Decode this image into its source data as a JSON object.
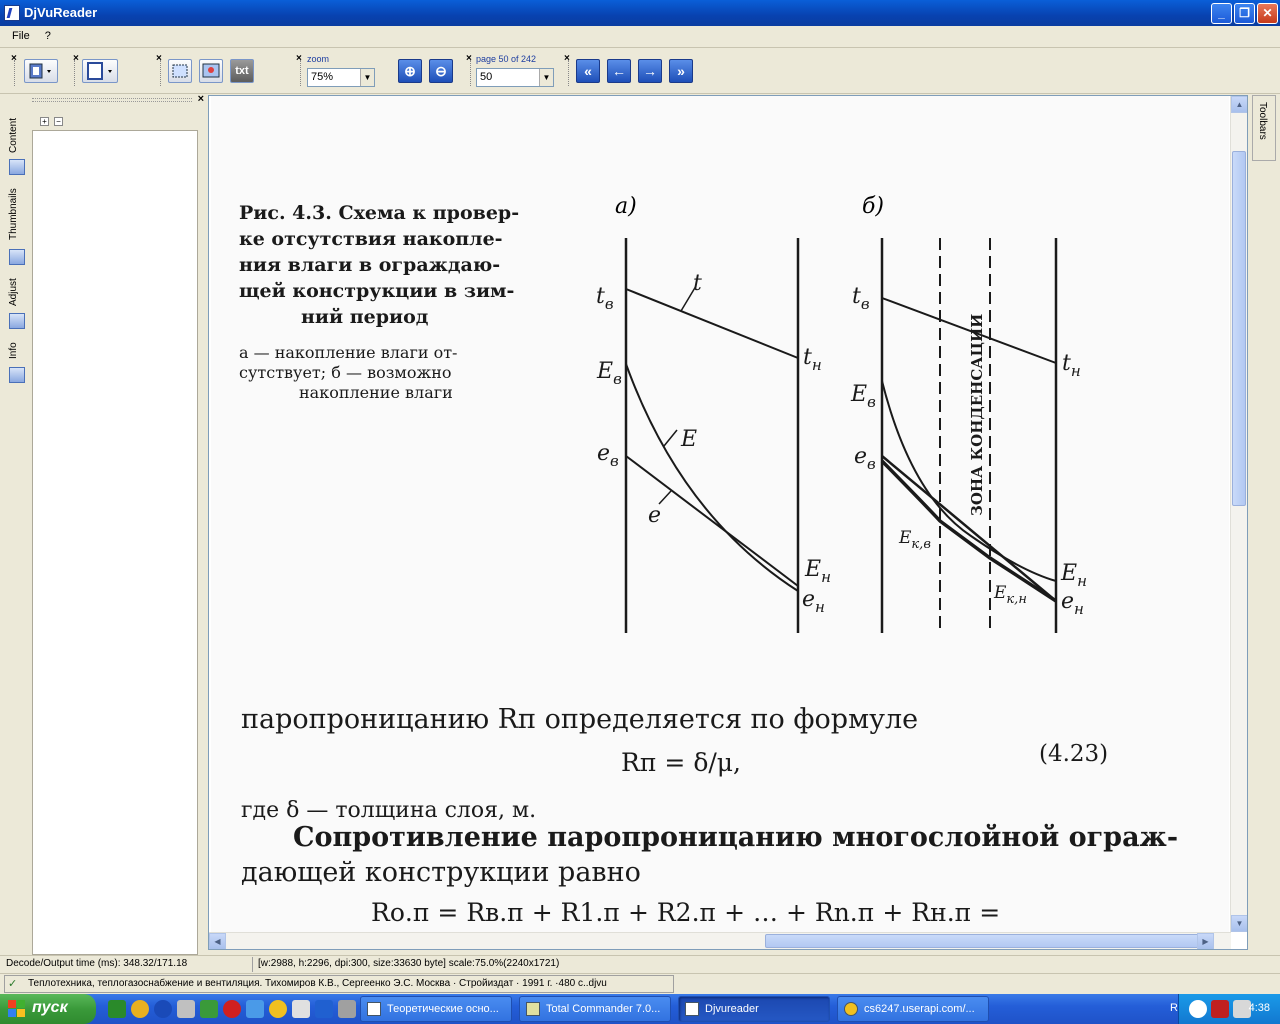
{
  "window": {
    "title": "DjVuReader"
  },
  "menu": {
    "file": "File",
    "help": "?"
  },
  "toolbar": {
    "zoom_label": "zoom",
    "zoom_value": "75%",
    "page_label": "page 50 of 242",
    "page_value": "50",
    "txt_label": "txt"
  },
  "side_tabs": [
    "Content",
    "Thumbnails",
    "Adjust",
    "Info"
  ],
  "right_tab": "Toolbars",
  "document": {
    "caption_title": "Рис. 4.3. Схема к проверке отсутствия накопления влаги в ограждающей конструкции в зимний период",
    "caption_line1": "Рис. 4.3. Схема к провер-",
    "caption_line2": "ке  отсутствия  накопле-",
    "caption_line3": "ния  влаги  в  ограждаю-",
    "caption_line4": "щей  конструкции  в  зим-",
    "caption_line5": "ний период",
    "legend_line1": "а — накопление   влаги   от-",
    "legend_line2": "сутствует;        б — возможно",
    "legend_line3": "накопление влаги",
    "panel_a": "а)",
    "panel_b": "б)",
    "zone_label": "ЗОНА КОНДЕНСАЦИИ",
    "text_line1": "паропроницанию Rп определяется по формуле",
    "formula1": "Rп = δ/μ,",
    "formula1_num": "(4.23)",
    "text_line2": "где δ — толщина слоя, м.",
    "text_line3": "Сопротивление паропроницанию многослойной ограж-",
    "text_line4": "дающей конструкции равно",
    "formula2": "Rо.п = Rв.п + R1.п + R2.п + … + Rn.п + Rн.п ="
  },
  "status": {
    "decode": "Decode/Output time (ms): 348.32/171.18",
    "info": "[w:2988, h:2296, dpi:300, size:33630 byte] scale:75.0%(2240x1721)",
    "file": "Теплотехника, теплогазоснабжение и вентиляция. Тихомиров К.В., Сергеенко Э.С. Москва · Стройиздат · 1991 г. ·480 с..djvu"
  },
  "taskbar": {
    "start": "пуск",
    "tasks": [
      "Теоретические осно...",
      "Total Commander 7.0...",
      "Djvureader",
      "cs6247.userapi.com/..."
    ],
    "lang": "RU",
    "clock": "4:38"
  }
}
